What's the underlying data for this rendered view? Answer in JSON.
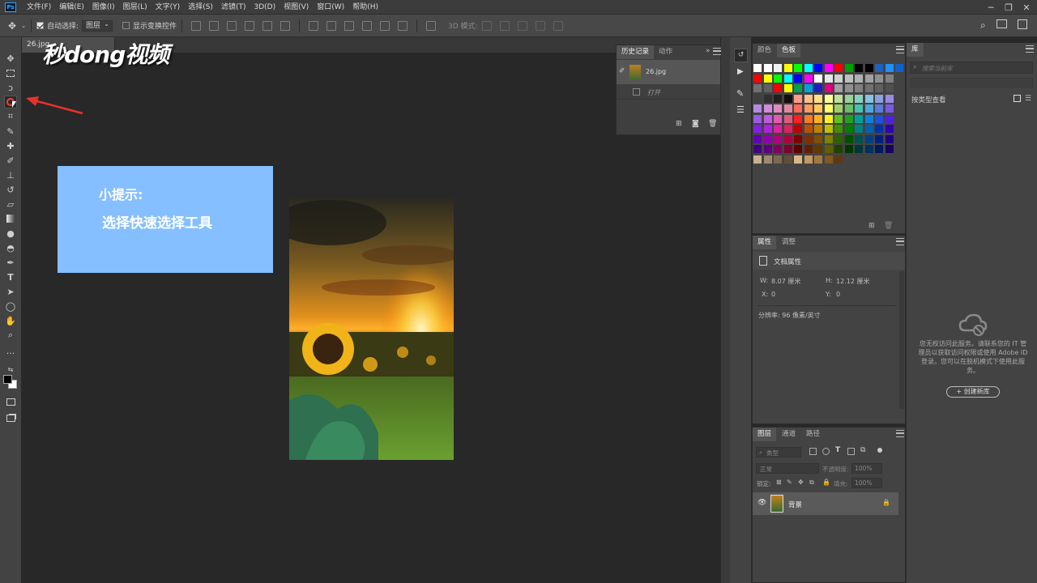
{
  "menubar": {
    "logo": "Ps",
    "items": [
      "文件(F)",
      "编辑(E)",
      "图像(I)",
      "图层(L)",
      "文字(Y)",
      "选择(S)",
      "滤镜(T)",
      "3D(D)",
      "视图(V)",
      "窗口(W)",
      "帮助(H)"
    ]
  },
  "options": {
    "auto_select_label": "自动选择:",
    "auto_select_value": "图层",
    "show_transform_label": "显示变换控件",
    "mode_3d_label": "3D 模式:"
  },
  "document": {
    "tab_name": "26.jpg"
  },
  "watermark": {
    "text": "秒dong视频"
  },
  "tip": {
    "title": "小提示:",
    "text": "选择快速选择工具"
  },
  "history": {
    "tabs": [
      "历史记录",
      "动作"
    ],
    "snapshot_name": "26.jpg",
    "step_label": "打开"
  },
  "swatches": {
    "tabs": [
      "颜色",
      "色板"
    ],
    "colors": [
      [
        "#ffffff",
        "#ffffff",
        "#f2f2f2",
        "#ffff00",
        "#00ff00",
        "#00ffff",
        "#0000ff",
        "#ff00ff",
        "#ff0000",
        "#00a000",
        "#000000",
        "#000000",
        "#2060c0",
        "#1e90ff",
        "#1060d0",
        "#8020a0"
      ],
      [
        "#ff0000",
        "#ffff00",
        "#00ff00",
        "#00ffff",
        "#0000ff",
        "#ff00ff",
        "#ffffff",
        "#e6e6e6",
        "#d0d0d0",
        "#bfbfbf",
        "#b0b0b0",
        "#a0a0a0",
        "#909090",
        "#808080"
      ],
      [
        "#707070",
        "#606060",
        "#ff0000",
        "#ffff00",
        "#00a050",
        "#00a0e0",
        "#2020c0",
        "#e0007f",
        "#a0a0a0",
        "#909090",
        "#808080",
        "#707070",
        "#606060",
        "#505050"
      ],
      [
        "#404040",
        "#303030",
        "#202020",
        "#101010",
        "#ff9a8a",
        "#ffbf8a",
        "#ffe08a",
        "#ffff99",
        "#bfe09a",
        "#9ad09a",
        "#8ad0c0",
        "#8ac0e0",
        "#8aa0e0",
        "#9a8ae0"
      ],
      [
        "#b08ae0",
        "#d08ae0",
        "#e08ac0",
        "#e08aa0",
        "#ff6a5a",
        "#ff9a5a",
        "#ffca5a",
        "#ffff66",
        "#9fd066",
        "#66c066",
        "#4ac0b0",
        "#4aa8e0",
        "#5a7ae0",
        "#7a5ae0"
      ],
      [
        "#9a5ae0",
        "#c05ae0",
        "#e05ab0",
        "#e05a80",
        "#ff2020",
        "#ff7a20",
        "#ffb020",
        "#fff020",
        "#60c020",
        "#20a020",
        "#00a0a0",
        "#1080e0",
        "#2050e0",
        "#5020e0"
      ],
      [
        "#8020e0",
        "#b020e0",
        "#e020a0",
        "#e02060",
        "#c00000",
        "#c05000",
        "#c08000",
        "#c0c000",
        "#409000",
        "#008000",
        "#008080",
        "#0060b0",
        "#0030b0",
        "#3000b0"
      ],
      [
        "#6000b0",
        "#9000b0",
        "#b00080",
        "#b00040",
        "#800000",
        "#803000",
        "#805000",
        "#808000",
        "#306000",
        "#005000",
        "#005050",
        "#004080",
        "#002080",
        "#200080"
      ],
      [
        "#400080",
        "#600080",
        "#800060",
        "#800030",
        "#600000",
        "#602000",
        "#603800",
        "#606000",
        "#204000",
        "#003800",
        "#003838",
        "#003060",
        "#001860",
        "#180060"
      ],
      [
        "#c8b090",
        "#a08870",
        "#806850",
        "#605038",
        "#d8b888",
        "#c09860",
        "#a07840",
        "#805820",
        "#603810"
      ]
    ]
  },
  "properties": {
    "tabs": [
      "属性",
      "调整"
    ],
    "section": "文档属性",
    "w_label": "W:",
    "w_value": "8.07 厘米",
    "h_label": "H:",
    "h_value": "12.12 厘米",
    "x_label": "X:",
    "x_value": "0",
    "y_label": "Y:",
    "y_value": "0",
    "resolution": "分辨率: 96 像素/英寸"
  },
  "layers": {
    "tabs": [
      "图层",
      "通道",
      "路径"
    ],
    "filter_kind": "类型",
    "blend_mode": "正常",
    "opacity_label": "不透明度:",
    "opacity_value": "100%",
    "lock_label": "锁定:",
    "fill_label": "填充:",
    "fill_value": "100%",
    "layer_name": "背景"
  },
  "library": {
    "tab": "库",
    "search_placeholder": "搜索当前库",
    "view_label": "按类型查看",
    "message": "您无权访问此服务。请联系您的 IT 管理员以获取访问权限或使用 Adobe ID 登录。您可以在脱机模式下使用此服务。",
    "create_button": "+ 创建新库"
  }
}
